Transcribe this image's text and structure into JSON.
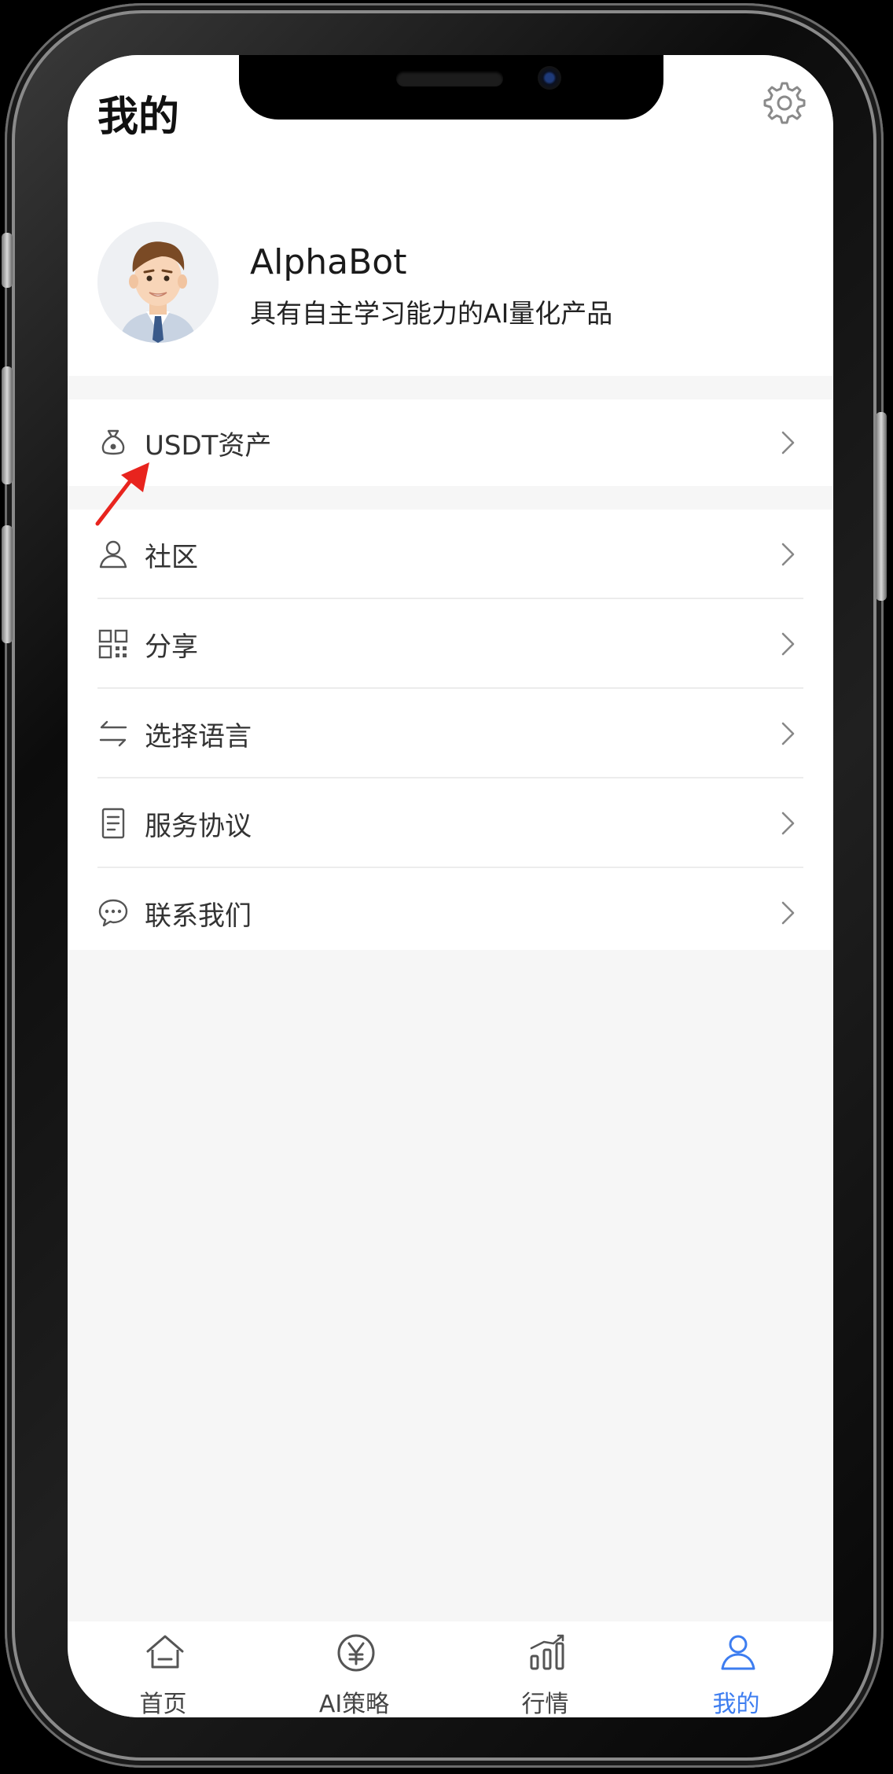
{
  "header": {
    "title": "我的"
  },
  "profile": {
    "name": "AlphaBot",
    "description": "具有自主学习能力的AI量化产品"
  },
  "menu": {
    "assets": {
      "label": "USDT资产",
      "icon": "money-bag-icon"
    },
    "items": [
      {
        "label": "社区",
        "icon": "user-icon"
      },
      {
        "label": "分享",
        "icon": "qr-code-icon"
      },
      {
        "label": "选择语言",
        "icon": "swap-arrows-icon"
      },
      {
        "label": "服务协议",
        "icon": "document-icon"
      },
      {
        "label": "联系我们",
        "icon": "chat-bubble-icon"
      }
    ]
  },
  "tabbar": {
    "tabs": [
      {
        "label": "首页",
        "icon": "home-icon",
        "active": false
      },
      {
        "label": "AI策略",
        "icon": "yen-coin-icon",
        "active": false
      },
      {
        "label": "行情",
        "icon": "bar-chart-icon",
        "active": false
      },
      {
        "label": "我的",
        "icon": "person-icon",
        "active": true
      }
    ]
  },
  "colors": {
    "accent": "#3d7df0",
    "annotation_arrow": "#e8241e",
    "page_background": "#f6f6f6"
  }
}
